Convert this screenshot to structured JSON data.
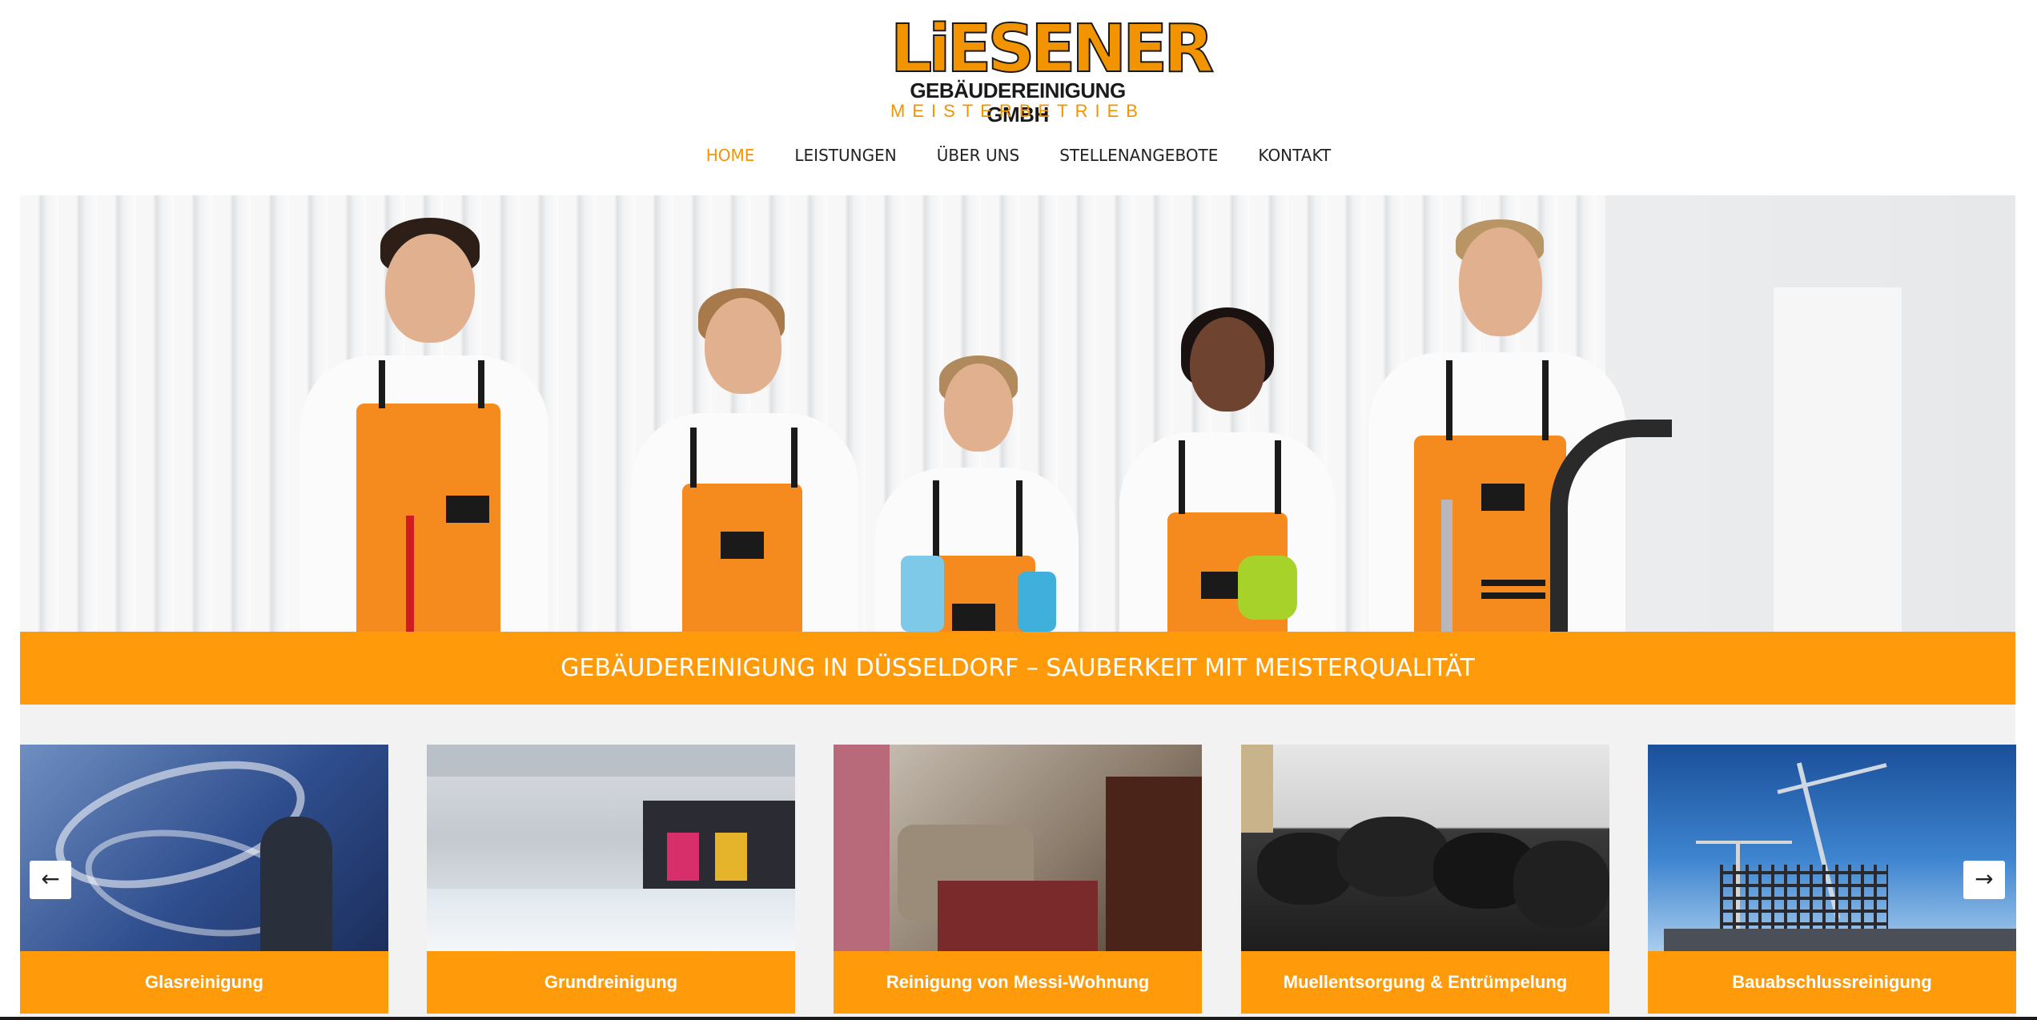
{
  "logo": {
    "word": "LiESENER",
    "company": "GEBÄUDEREINIGUNG GMBH",
    "tagline": "MEISTERBETRIEB"
  },
  "nav": {
    "items": [
      "HOME",
      "LEISTUNGEN",
      "ÜBER UNS",
      "STELLENANGEBOTE",
      "KONTAKT"
    ],
    "active": "HOME"
  },
  "hero": {
    "banner": "GEBÄUDEREINIGUNG IN DÜSSELDORF – SAUBERKEIT MIT MEISTERQUALITÄT"
  },
  "services": {
    "cards": [
      "Glasreinigung",
      "Grundreinigung",
      "Reinigung von Messi-Wohnung",
      "Muellentsorgung & Entrümpelung",
      "Bauabschlussreinigung"
    ],
    "prev_icon": "arrow-left-icon",
    "next_icon": "arrow-right-icon"
  },
  "colors": {
    "brand_orange": "#ff9a0a",
    "nav_active": "#f29400",
    "text_dark": "#222222"
  }
}
